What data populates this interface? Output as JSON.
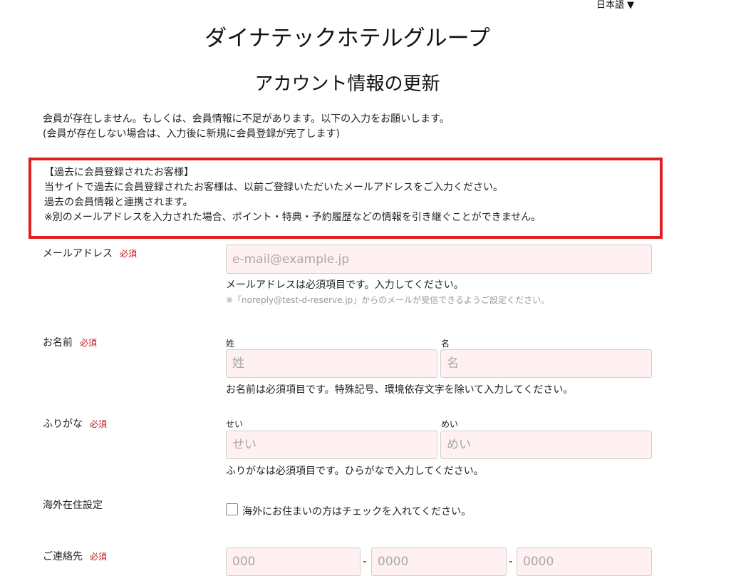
{
  "header": {
    "language_selector": "日本語 ▼",
    "brand": "ダイナテックホテルグループ",
    "title": "アカウント情報の更新"
  },
  "intro": {
    "line1": "会員が存在しません。もしくは、会員情報に不足があります。以下の入力をお願いします。",
    "line2": "(会員が存在しない場合は、入力後に新規に会員登録が完了します)"
  },
  "notice": {
    "heading": "【過去に会員登録されたお客様】",
    "line1": "当サイトで過去に会員登録されたお客様は、以前ご登録いただいたメールアドレスをご入力ください。",
    "line2": "過去の会員情報と連携されます。",
    "line3": "※別のメールアドレスを入力された場合、ポイント・特典・予約履歴などの情報を引き継ぐことができません。"
  },
  "required_label": "必須",
  "email": {
    "label": "メールアドレス",
    "placeholder": "e-mail@example.jp",
    "value": "",
    "help": "メールアドレスは必須項目です。入力してください。",
    "note": "※「noreply@test-d-reserve.jp」からのメールが受信できるようご設定ください。"
  },
  "name": {
    "label": "お名前",
    "last_label": "姓",
    "last_placeholder": "姓",
    "first_label": "名",
    "first_placeholder": "名",
    "help": "お名前は必須項目です。特殊記号、環境依存文字を除いて入力してください。"
  },
  "kana": {
    "label": "ふりがな",
    "last_label": "せい",
    "last_placeholder": "せい",
    "first_label": "めい",
    "first_placeholder": "めい",
    "help": "ふりがなは必須項目です。ひらがなで入力してください。"
  },
  "overseas": {
    "label": "海外在住設定",
    "checkbox_label": "海外にお住まいの方はチェックを入れてください。",
    "checked": false
  },
  "contact": {
    "label": "ご連絡先",
    "part1_placeholder": "000",
    "separator": "-",
    "part2_placeholder": "0000",
    "part3_placeholder": "0000"
  }
}
